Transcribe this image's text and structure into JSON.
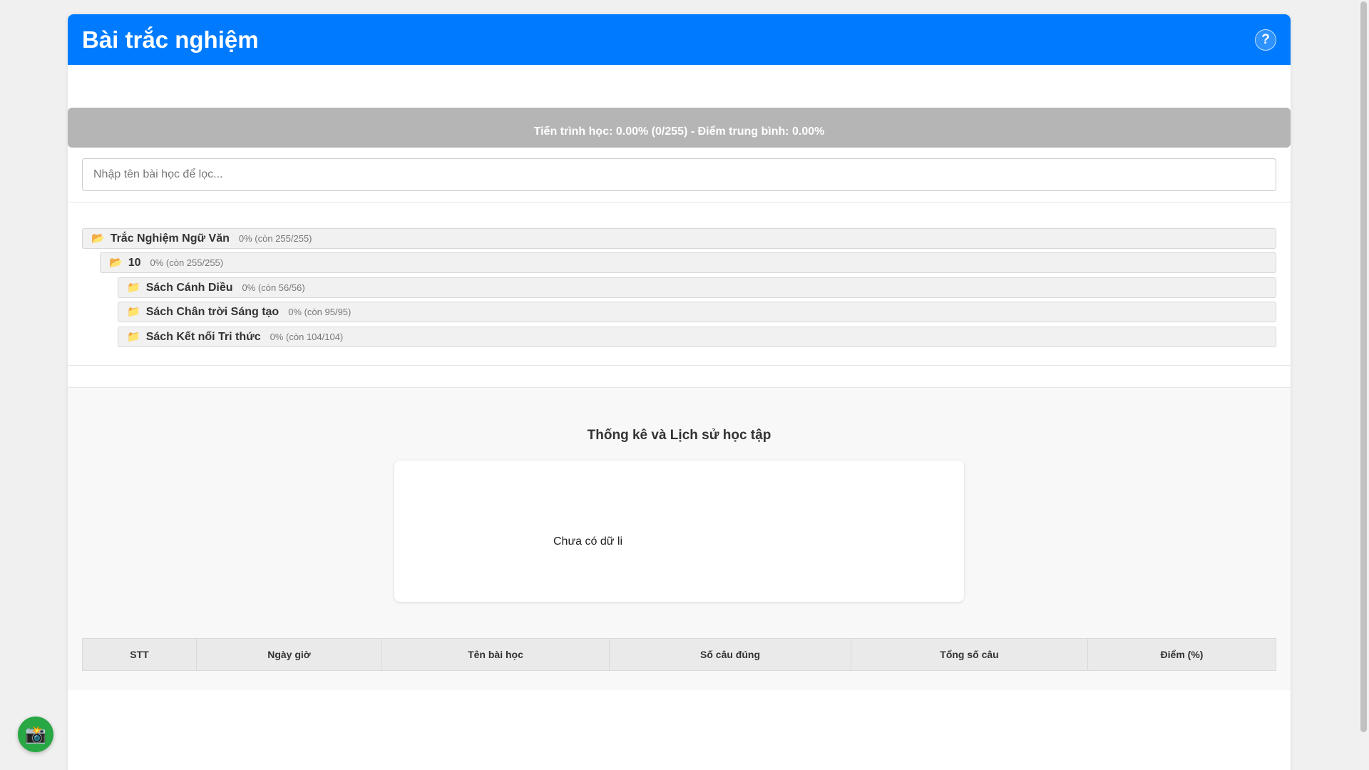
{
  "header": {
    "title": "Bài trắc nghiệm",
    "help_label": "?"
  },
  "progress": {
    "text": "Tiến trình học: 0.00% (0/255) - Điểm trung bình: 0.00%",
    "fraction": 0
  },
  "filter": {
    "placeholder": "Nhập tên bài học để lọc...",
    "value": ""
  },
  "tree": [
    {
      "icon": "📂",
      "name": "Trắc Nghiệm Ngữ Văn",
      "stat": "0% (còn 255/255)",
      "level": 0,
      "expanded": true
    },
    {
      "icon": "📂",
      "name": "10",
      "stat": "0% (còn 255/255)",
      "level": 1,
      "expanded": true
    },
    {
      "icon": "📁",
      "name": "Sách Cánh Diều",
      "stat": "0% (còn 56/56)",
      "level": 2,
      "expanded": false
    },
    {
      "icon": "📁",
      "name": "Sách Chân trời Sáng tạo",
      "stat": "0% (còn 95/95)",
      "level": 2,
      "expanded": false
    },
    {
      "icon": "📁",
      "name": "Sách Kết nối Tri thức",
      "stat": "0% (còn 104/104)",
      "level": 2,
      "expanded": false
    }
  ],
  "stats": {
    "title": "Thống kê và Lịch sử học tập",
    "chart_empty_text": "Chưa có dữ li",
    "table_headers": [
      "STT",
      "Ngày giờ",
      "Tên bài học",
      "Số câu đúng",
      "Tổng số câu",
      "Điểm (%)"
    ]
  },
  "fab": {
    "icon": "📸"
  },
  "colors": {
    "primary": "#007bff",
    "progress_bg": "#b5b5b5",
    "fab": "#28a745"
  }
}
